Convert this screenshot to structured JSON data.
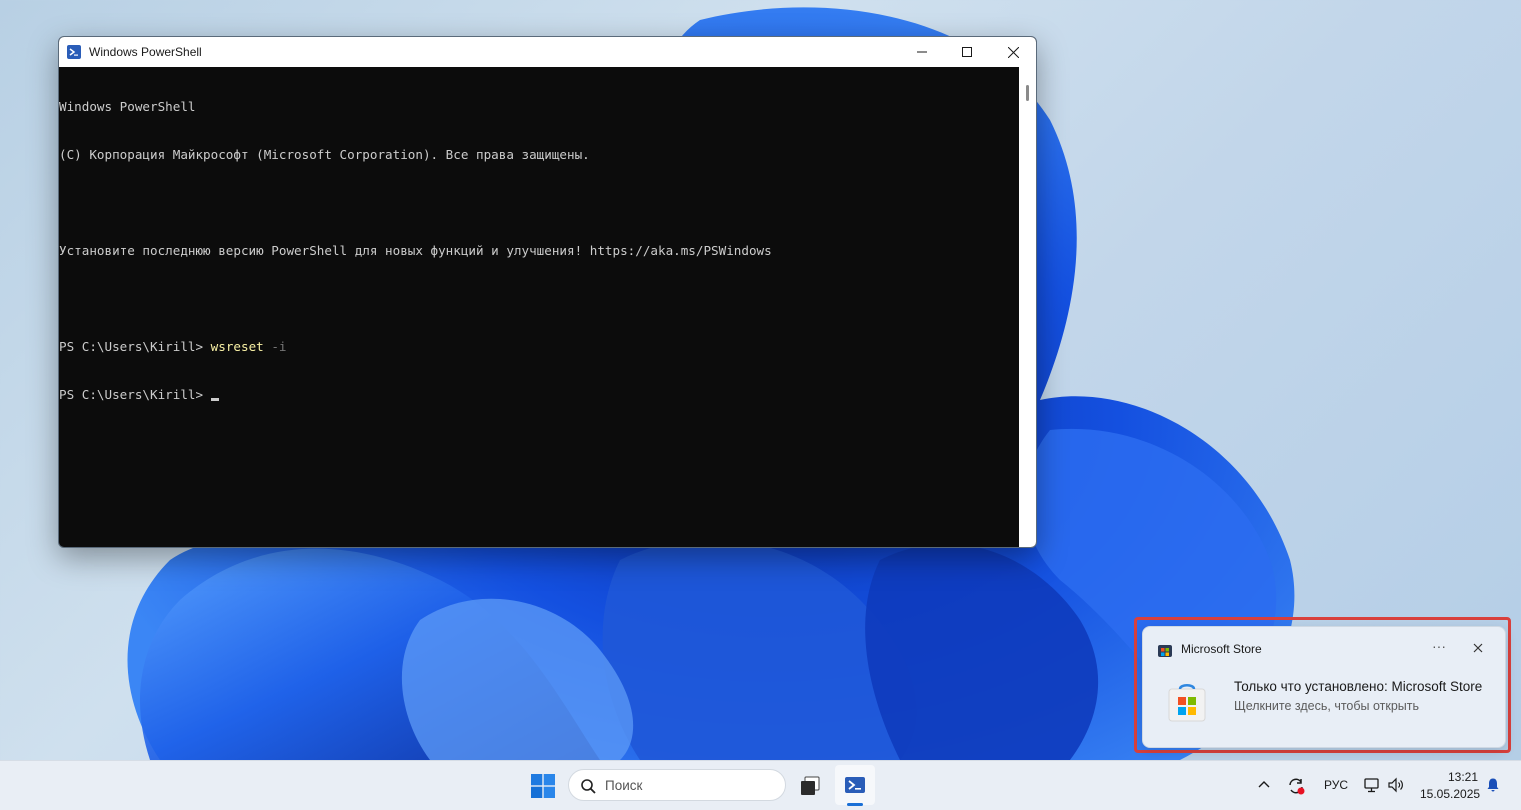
{
  "powershell": {
    "title": "Windows PowerShell",
    "lines": [
      "Windows PowerShell",
      "(C) Корпорация Майкрософт (Microsoft Corporation). Все права защищены.",
      "",
      "Установите последнюю версию PowerShell для новых функций и улучшения! https://aka.ms/PSWindows",
      ""
    ],
    "prompt1": "PS C:\\Users\\Kirill> ",
    "command": "wsreset",
    "param": " -i",
    "prompt2": "PS C:\\Users\\Kirill> "
  },
  "notification": {
    "app_name": "Microsoft Store",
    "more_label": "···",
    "title": "Только что установлено: Microsoft Store",
    "subtitle": "Щелкните здесь, чтобы открыть"
  },
  "taskbar": {
    "search_placeholder": "Поиск",
    "language": "РУС",
    "time": "13:21",
    "date": "15.05.2025"
  },
  "colors": {
    "highlight": "#d9403c",
    "accent": "#1a6fd6",
    "console_bg": "#0c0c0c",
    "command": "#f9f1a5"
  }
}
